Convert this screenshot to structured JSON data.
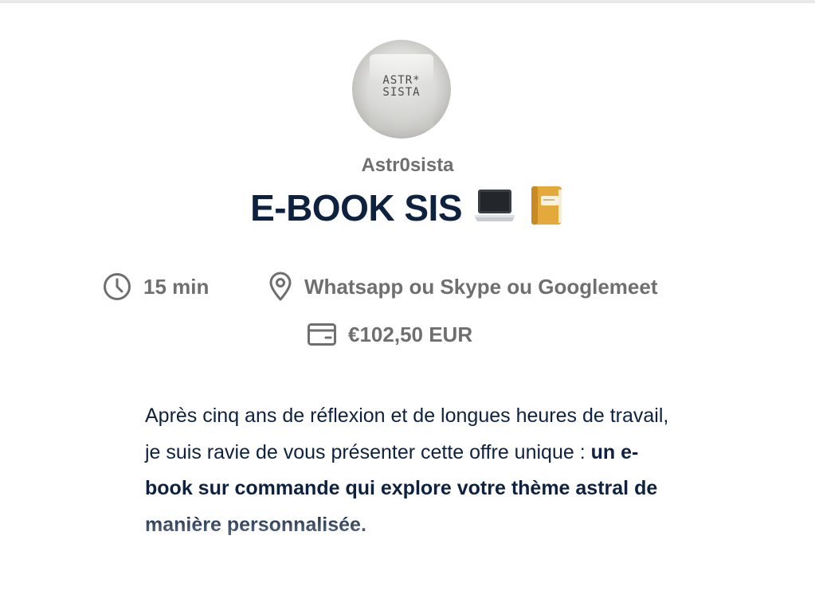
{
  "profile": {
    "avatar_logo_text": "ASTR*\nSISTA",
    "author": "Astr0sista"
  },
  "event": {
    "title": "E-BOOK SIS",
    "title_emojis": [
      "laptop-emoji",
      "notebook-emoji"
    ],
    "duration": "15 min",
    "location": "Whatsapp ou Skype ou Googlemeet",
    "price": "€102,50 EUR"
  },
  "description": {
    "part1": "Après cinq ans de réflexion et de longues heures de travail, je suis ravie de vous présenter cette offre unique : ",
    "bold": "un e-book sur commande qui explore votre thème astral de manière personnalisée."
  },
  "colors": {
    "title": "#0e2240",
    "meta_text": "#6f6f6f",
    "body_text": "#0e2240"
  },
  "icons": [
    "clock-icon",
    "location-pin-icon",
    "card-icon"
  ]
}
